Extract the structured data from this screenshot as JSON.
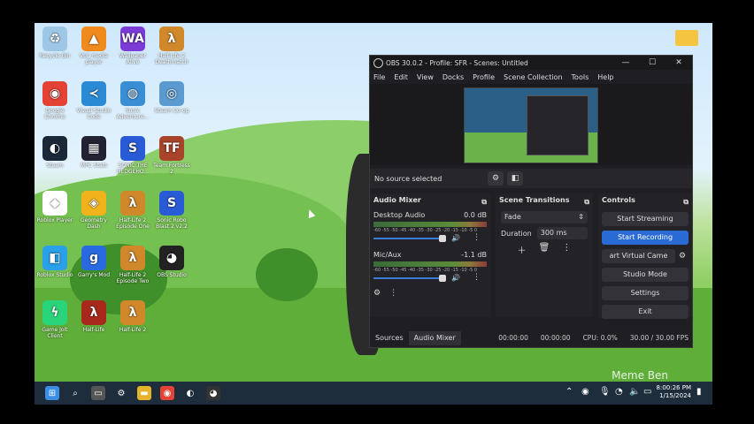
{
  "desktop": {
    "icons": [
      {
        "label": "Recycle Bin",
        "icon": "recycle-bin-icon",
        "color": "#9ec7e6",
        "glyph": "♻"
      },
      {
        "label": "VLC media player",
        "icon": "vlc-icon",
        "color": "#f08a1c",
        "glyph": "▲"
      },
      {
        "label": "Wallpaper Alive",
        "icon": "wallpaper-alive-icon",
        "color": "#7c3bd6",
        "glyph": "WA"
      },
      {
        "label": "Half-Life 2 Deathmatch",
        "icon": "half-life-icon",
        "color": "#d0882a",
        "glyph": "λ"
      },
      {
        "label": "Google Chrome",
        "icon": "chrome-icon",
        "color": "#e44234",
        "glyph": "◉"
      },
      {
        "label": "Visual Studio Code",
        "icon": "vscode-icon",
        "color": "#2a8ad4",
        "glyph": "≺"
      },
      {
        "label": "Sonic Adventure...",
        "icon": "sonic-adventure-icon",
        "color": "#3a8ed4",
        "glyph": "◍"
      },
      {
        "label": "Steam Co-op",
        "icon": "steam-coop-icon",
        "color": "#5a9ad0",
        "glyph": "◎"
      },
      {
        "label": "Steam",
        "icon": "steam-icon",
        "color": "#1b2838",
        "glyph": "◐"
      },
      {
        "label": "MPC Stats",
        "icon": "mpc-stats-icon",
        "color": "#223",
        "glyph": "▦"
      },
      {
        "label": "SONIC THE HEDGEHO...",
        "icon": "sonic-icon",
        "color": "#2a5bd6",
        "glyph": "S"
      },
      {
        "label": "Team Fortress 2",
        "icon": "tf2-icon",
        "color": "#a8442a",
        "glyph": "TF"
      },
      {
        "label": "Roblox Player",
        "icon": "roblox-icon",
        "color": "#fff",
        "glyph": "◆"
      },
      {
        "label": "Geometry Dash",
        "icon": "geometry-dash-icon",
        "color": "#f2b21c",
        "glyph": "◈"
      },
      {
        "label": "Half-Life 2 Episode One",
        "icon": "half-life-ep1-icon",
        "color": "#d0882a",
        "glyph": "λ"
      },
      {
        "label": "Sonic Robo Blast 2 v2.2",
        "icon": "srb2-icon",
        "color": "#2a5bd6",
        "glyph": "S"
      },
      {
        "label": "Roblox Studio",
        "icon": "roblox-studio-icon",
        "color": "#2aa0e8",
        "glyph": "◧"
      },
      {
        "label": "Garry's Mod",
        "icon": "garrys-mod-icon",
        "color": "#2a6ae0",
        "glyph": "g"
      },
      {
        "label": "Half-Life 2 Episode Two",
        "icon": "half-life-ep2-icon",
        "color": "#d0882a",
        "glyph": "λ"
      },
      {
        "label": "OBS Studio",
        "icon": "obs-icon",
        "color": "#222",
        "glyph": "◕"
      },
      {
        "label": "Game Jolt Client",
        "icon": "game-jolt-icon",
        "color": "#2ad47a",
        "glyph": "ϟ"
      },
      {
        "label": "Half-Life",
        "icon": "half-life-1-icon",
        "color": "#a8281c",
        "glyph": "λ"
      },
      {
        "label": "Half-Life 2",
        "icon": "half-life-2-icon",
        "color": "#d0882a",
        "glyph": "λ"
      }
    ],
    "watermark": "Meme Ben"
  },
  "taskbar": {
    "icons": [
      {
        "name": "start-icon",
        "color": "#3a8ee6",
        "glyph": "⊞"
      },
      {
        "name": "search-icon",
        "color": "transparent",
        "glyph": "⌕"
      },
      {
        "name": "task-view-icon",
        "color": "#555",
        "glyph": "▭"
      },
      {
        "name": "settings-icon",
        "color": "transparent",
        "glyph": "⚙"
      },
      {
        "name": "file-explorer-icon",
        "color": "#e6b42a",
        "glyph": "▬"
      },
      {
        "name": "chrome-icon",
        "color": "#e44234",
        "glyph": "◉"
      },
      {
        "name": "steam-icon",
        "color": "transparent",
        "glyph": "◐"
      },
      {
        "name": "obs-icon",
        "color": "#333",
        "glyph": "◕"
      }
    ],
    "time": "8:00:26 PM",
    "date": "1/15/2024"
  },
  "obs": {
    "title": "OBS 30.0.2 - Profile: SFR - Scenes: Untitled",
    "menu": [
      "File",
      "Edit",
      "View",
      "Docks",
      "Profile",
      "Scene Collection",
      "Tools",
      "Help"
    ],
    "no_source": "No source selected",
    "audio_mixer": {
      "title": "Audio Mixer",
      "tracks": [
        {
          "name": "Desktop Audio",
          "db": "0.0 dB",
          "volume": 0.95
        },
        {
          "name": "Mic/Aux",
          "db": "-1.1 dB",
          "volume": 0.95
        }
      ],
      "scale": "-60 -55 -50 -45 -40 -35 -30 -25 -20 -15 -10 -5 0"
    },
    "scene_transitions": {
      "title": "Scene Transitions",
      "selected": "Fade",
      "duration_label": "Duration",
      "duration_value": "300 ms"
    },
    "controls": {
      "title": "Controls",
      "start_streaming": "Start Streaming",
      "start_recording": "Start Recording",
      "start_virtual_camera": "art Virtual Came",
      "studio_mode": "Studio Mode",
      "settings": "Settings",
      "exit": "Exit"
    },
    "tabs": [
      "Sources",
      "Audio Mixer"
    ],
    "status": {
      "rec_time": "00:00:00",
      "stream_time": "00:00:00",
      "cpu": "CPU: 0.0%",
      "fps": "30.00 / 30.00 FPS"
    }
  }
}
